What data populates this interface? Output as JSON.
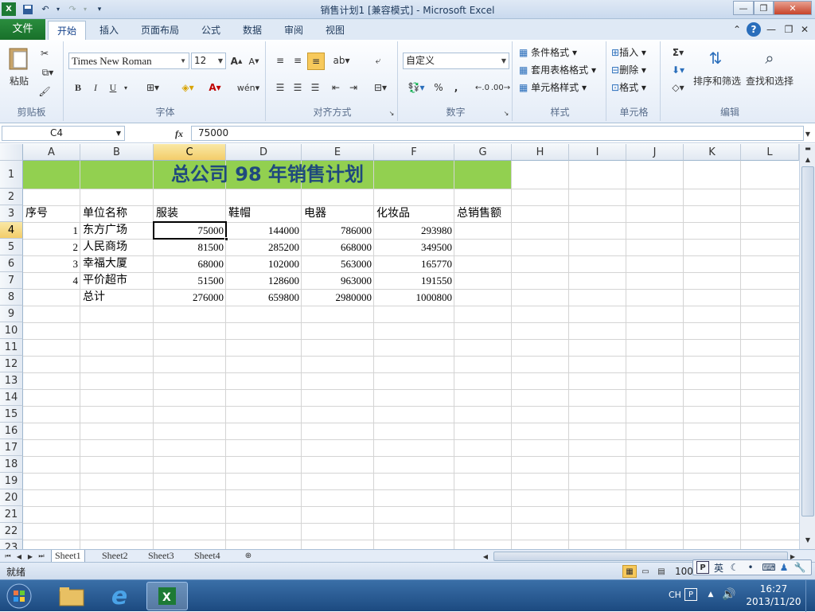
{
  "window": {
    "title": "销售计划1  [兼容模式] - Microsoft Excel",
    "app_icon": "excel-icon"
  },
  "ribbon": {
    "file_tab": "文件",
    "tabs": [
      "开始",
      "插入",
      "页面布局",
      "公式",
      "数据",
      "审阅",
      "视图"
    ],
    "active_tab": "开始",
    "groups": {
      "clipboard": {
        "label": "剪贴板",
        "paste": "粘贴"
      },
      "font": {
        "label": "字体",
        "font_name": "Times New Roman",
        "font_size": "12",
        "bold": "B",
        "italic": "I",
        "underline": "U"
      },
      "alignment": {
        "label": "对齐方式"
      },
      "number": {
        "label": "数字",
        "format": "自定义",
        "percent": "%",
        "comma": ","
      },
      "styles": {
        "label": "样式",
        "conditional": "条件格式",
        "table": "套用表格格式",
        "cell_styles": "单元格样式"
      },
      "cells": {
        "label": "单元格",
        "insert": "插入",
        "delete": "删除",
        "format": "格式"
      },
      "editing": {
        "label": "编辑",
        "sort_filter": "排序和筛选",
        "find_select": "查找和选择",
        "sigma": "Σ"
      }
    }
  },
  "formula_bar": {
    "name_box": "C4",
    "fx": "fx",
    "value": "75000"
  },
  "sheet": {
    "columns": [
      "A",
      "B",
      "C",
      "D",
      "E",
      "F",
      "G",
      "H",
      "I",
      "J",
      "K",
      "L"
    ],
    "selected_column": "C",
    "rows": [
      "1",
      "2",
      "3",
      "4",
      "5",
      "6",
      "7",
      "8",
      "9",
      "10",
      "11",
      "12",
      "13",
      "14",
      "15",
      "16",
      "17",
      "18",
      "19",
      "20",
      "21",
      "22",
      "23"
    ],
    "selected_row": "4",
    "title": "总公司 98 年销售计划",
    "headers": [
      "序号",
      "单位名称",
      "服装",
      "鞋帽",
      "电器",
      "化妆品",
      "总销售额"
    ],
    "data": [
      [
        "1",
        "东方广场",
        "75000",
        "144000",
        "786000",
        "293980"
      ],
      [
        "2",
        "人民商场",
        "81500",
        "285200",
        "668000",
        "349500"
      ],
      [
        "3",
        "幸福大厦",
        "68000",
        "102000",
        "563000",
        "165770"
      ],
      [
        "4",
        "平价超市",
        "51500",
        "128600",
        "963000",
        "191550"
      ]
    ],
    "total": [
      "总计",
      "276000",
      "659800",
      "2980000",
      "1000800"
    ],
    "title_fill": "#92d050",
    "title_color": "#1f497d"
  },
  "sheet_tabs": [
    "Sheet1",
    "Sheet2",
    "Sheet3",
    "Sheet4"
  ],
  "active_sheet": "Sheet1",
  "status": {
    "ready": "就绪",
    "zoom": "100"
  },
  "ime": {
    "label": "英"
  },
  "taskbar": {
    "lang": "CH",
    "time": "16:27",
    "date": "2013/11/20"
  }
}
